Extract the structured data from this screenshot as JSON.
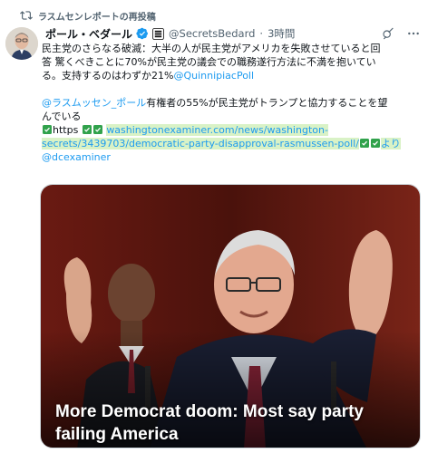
{
  "repost": {
    "label": "ラスムセンレポートの再投稿"
  },
  "author": {
    "name": "ポール・ベダール",
    "handle": "@SecretsBedard",
    "separator": "·",
    "time": "3時間"
  },
  "tweet": {
    "line1": "民主党のさらなる破滅：大半の人が民主党がアメリカを失敗させていると回",
    "line2": "答 驚くべきことに70%が民主党の議会での職務遂行方法に不満を抱いてい",
    "line3_text": "る。支持するのはわずか21%",
    "line3_mention": "@QuinnipiacPoll",
    "para2_mention": "@ラスムッセン_ポール",
    "para2_text": "有権者の55%が民主党がトランプと協力することを望",
    "para2_line2": "んでいる",
    "link_prefix": "https",
    "url_line1": "washingtonexaminer.com/news/washington-",
    "url_line2": "secrets/3439703/democratic-party-disapproval-rasmussen-poll/",
    "tail_yori": "より",
    "tail_mention": "@dcexaminer"
  },
  "card": {
    "headline": "More Democrat doom: Most say party failing America"
  },
  "icons": {
    "repost": "repost-icon",
    "verified": "verified-badge-icon",
    "affiliation": "affiliation-badge-icon",
    "grok": "grok-icon",
    "more": "more-options-icon",
    "check": "check-mark-icon"
  },
  "colors": {
    "accent": "#1d9bf0",
    "check_green": "#31a24c",
    "url_highlight": "#d9f2c6",
    "secondary": "#536471"
  }
}
